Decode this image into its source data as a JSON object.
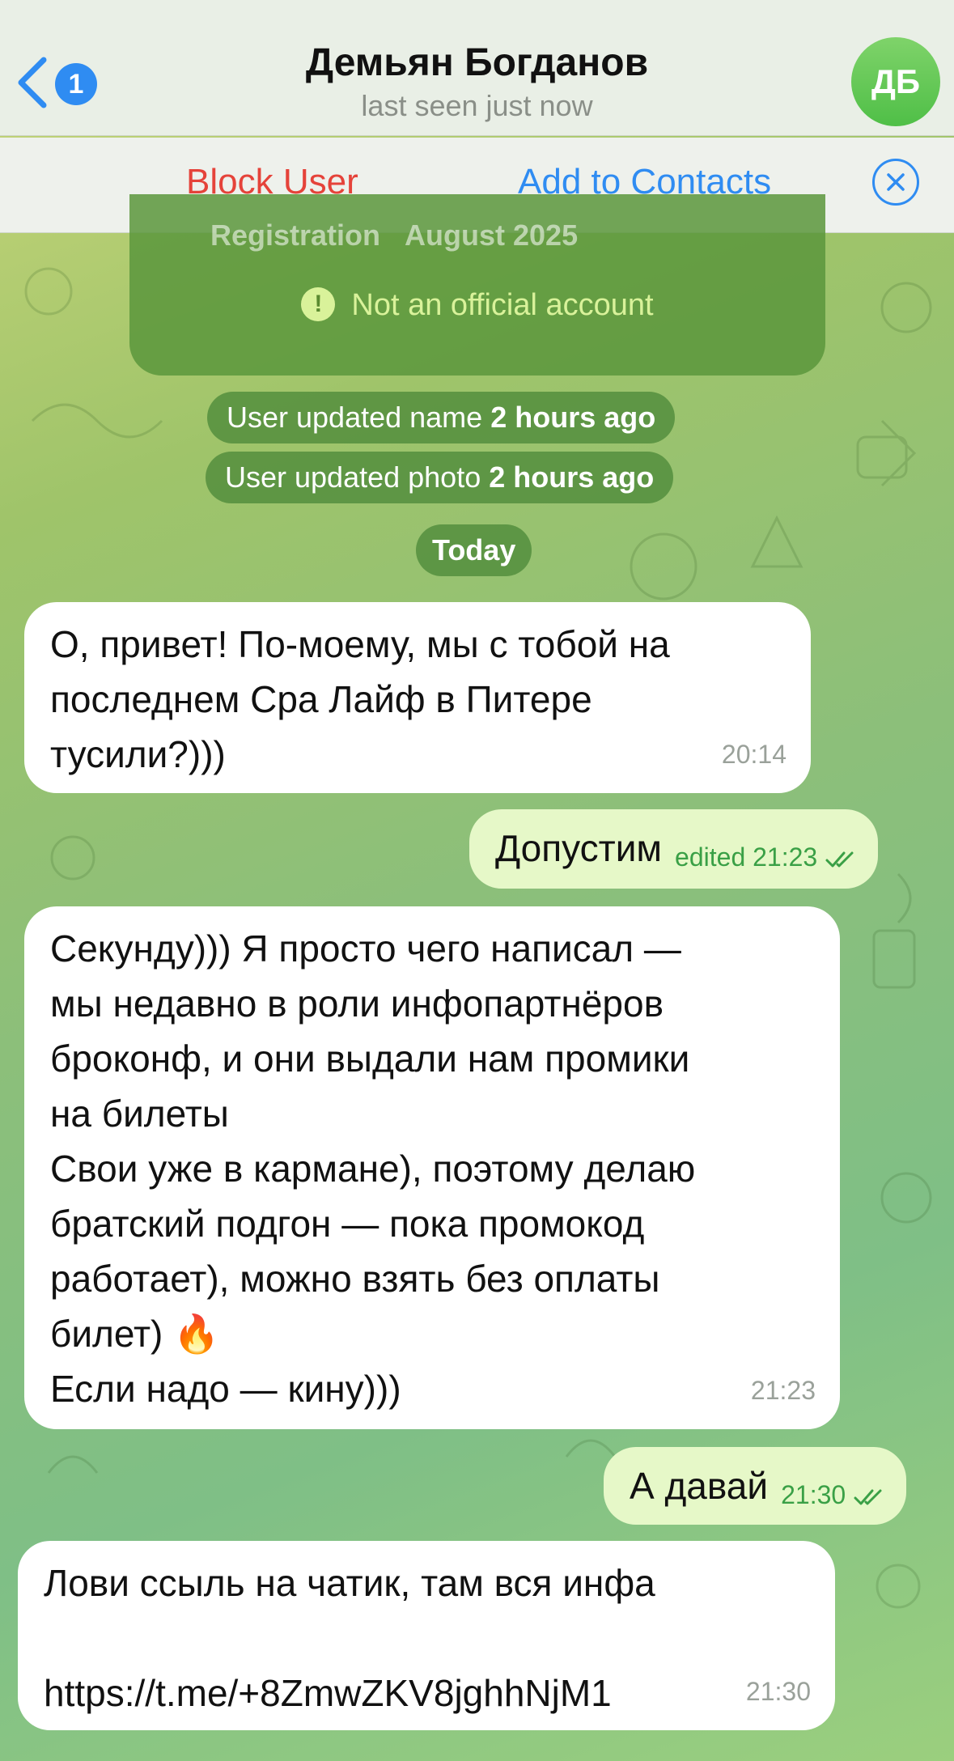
{
  "header": {
    "back_badge": "1",
    "title": "Демьян Богданов",
    "status": "last seen just now",
    "avatar_initials": "ДБ"
  },
  "actions": {
    "block_label": "Block User",
    "add_label": "Add to Contacts"
  },
  "info_card": {
    "registration_label": "Registration",
    "registration_value": "August 2025",
    "official_notice": "Not an official account"
  },
  "service": {
    "name_update_text": "User updated name",
    "name_update_time": "2 hours ago",
    "photo_update_text": "User updated photo",
    "photo_update_time": "2 hours ago",
    "date_divider": "Today"
  },
  "messages": [
    {
      "direction": "incoming",
      "text": "О, привет! По-моему, мы с тобой на\nпоследнем Сра Лайф в Питере\nтусили?)))",
      "time": "20:14"
    },
    {
      "direction": "outgoing",
      "text": "Допустим",
      "time": "edited 21:23"
    },
    {
      "direction": "incoming",
      "text": "Секунду))) Я просто чего написал —\nмы недавно в роли инфопартнёров\nброконф, и они выдали нам промики\nна билеты\nСвои уже в кармане), поэтому делаю\nбратский подгон — пока промокод\nработает), можно взять без оплаты\nбилет) 🔥\nЕсли надо — кину)))",
      "time": "21:23"
    },
    {
      "direction": "outgoing",
      "text": "А давай",
      "time": "21:30"
    },
    {
      "direction": "incoming",
      "text": "Лови ссыль на чатик, там вся инфа\n\nhttps://t.me/+8ZmwZKV8jghhNjM1",
      "time": "21:30"
    }
  ],
  "colors": {
    "accent_blue": "#2f8cf2",
    "block_red": "#e5433a",
    "outgoing_bubble": "#e6f8c8",
    "outgoing_time": "#3aa046"
  }
}
